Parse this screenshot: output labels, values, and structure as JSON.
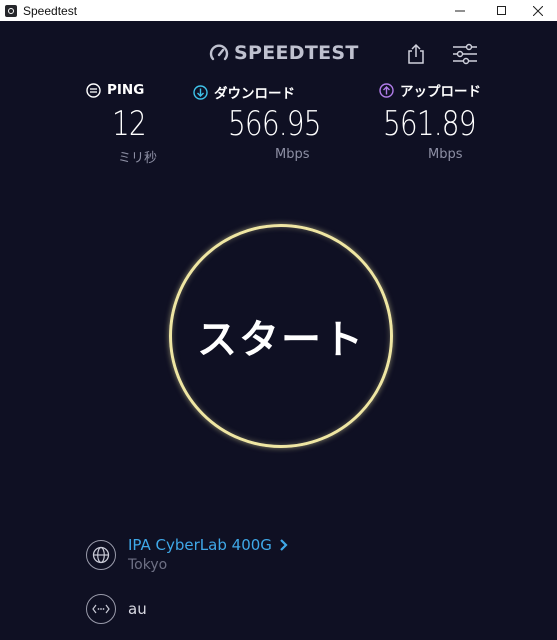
{
  "window": {
    "title": "Speedtest"
  },
  "header": {
    "logo_text": "SPEEDTEST"
  },
  "metrics": {
    "ping": {
      "label": "PING",
      "value": "12",
      "unit": "ミリ秒",
      "color": "#ffffff"
    },
    "download": {
      "label": "ダウンロード",
      "value": "566.95",
      "unit": "Mbps",
      "color": "#3fc3ea"
    },
    "upload": {
      "label": "アップロード",
      "value": "561.89",
      "unit": "Mbps",
      "color": "#b07ce8"
    }
  },
  "start_button": {
    "label": "スタート",
    "ring_color": "#efe6a3"
  },
  "server": {
    "name": "IPA CyberLab 400G",
    "location": "Tokyo"
  },
  "provider": {
    "name": "au"
  },
  "icons": [
    "speedtest-logo-icon",
    "share-icon",
    "settings-sliders-icon",
    "globe-icon",
    "network-icon",
    "chevron-right-icon"
  ]
}
